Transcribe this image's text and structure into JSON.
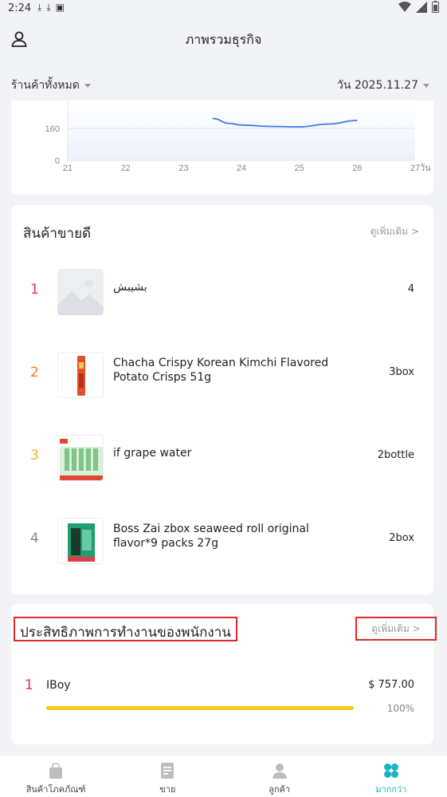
{
  "status_bar": {
    "time": "2:24"
  },
  "header": {
    "title": "ภาพรวมธุรกิจ"
  },
  "filters": {
    "store": "ร้านค้าทั้งหมด",
    "date": "วัน 2025.11.27"
  },
  "chart_data": {
    "type": "line",
    "x": [
      21,
      22,
      23,
      24,
      25,
      26,
      27
    ],
    "x_unit": "วัน",
    "ytick_labels": [
      "0",
      "160"
    ],
    "series": [
      {
        "x": [
          23.5,
          23.8,
          24.0,
          24.5,
          25.0,
          25.5,
          26.0
        ],
        "values": [
          210,
          185,
          177,
          170,
          168,
          182,
          200
        ]
      }
    ],
    "ylim": [
      0,
      250
    ],
    "grid": true,
    "color": "#3a7bef"
  },
  "top_products": {
    "title": "สินค้าขายดี",
    "more": "ดูเพิ่มเติม >",
    "items": [
      {
        "rank": "1",
        "name": "بشيبش",
        "qty": "4",
        "rank_color": "#e0393e"
      },
      {
        "rank": "2",
        "name": "Chacha Crispy Korean Kimchi Flavored Potato Crisps 51g",
        "qty": "3box",
        "rank_color": "#f07f1a"
      },
      {
        "rank": "3",
        "name": "if grape water",
        "qty": "2bottle",
        "rank_color": "#f0b51a"
      },
      {
        "rank": "4",
        "name": "Boss Zai zbox seaweed roll original flavor*9 packs 27g",
        "qty": "2box",
        "rank_color": "#888888"
      }
    ]
  },
  "employee_performance": {
    "title": "ประสิทธิภาพการทำงานของพนักงาน",
    "more": "ดูเพิ่มเติม >",
    "items": [
      {
        "rank": "1",
        "name": "IBoy",
        "amount": "$ 757.00",
        "percent": "100%",
        "progress": 1.0
      }
    ]
  },
  "bottom_nav": {
    "items": [
      {
        "label": "สินค้าโภคภัณฑ์",
        "icon": "bag-icon"
      },
      {
        "label": "ขาย",
        "icon": "document-icon"
      },
      {
        "label": "ลูกค้า",
        "icon": "customer-icon"
      },
      {
        "label": "มากกว่า",
        "icon": "clover-icon",
        "active": true
      }
    ]
  }
}
